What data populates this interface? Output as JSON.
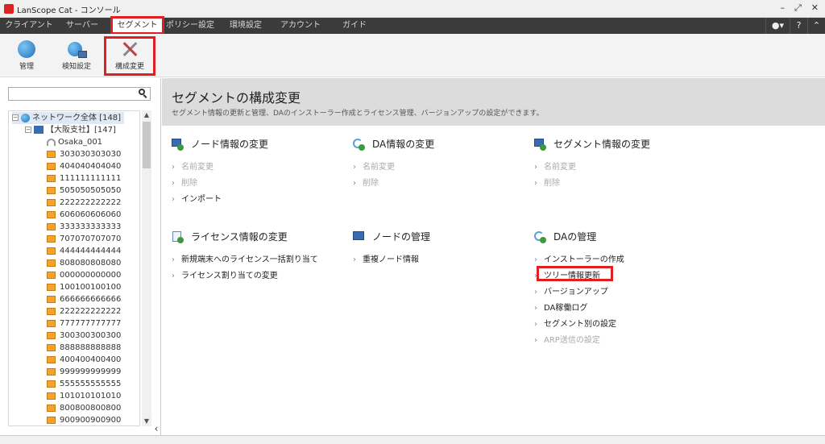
{
  "window": {
    "title": "LanScope Cat - コンソール",
    "controls": [
      "–",
      "⤢",
      "✕"
    ]
  },
  "menubar": {
    "tabs": [
      {
        "label": "クライアント",
        "active": false
      },
      {
        "label": "サーバー",
        "active": false
      },
      {
        "label": "セグメント",
        "active": true
      },
      {
        "label": "ポリシー設定",
        "active": false
      },
      {
        "label": "環境設定",
        "active": false
      },
      {
        "label": "アカウント",
        "active": false
      },
      {
        "label": "ガイド",
        "active": false
      }
    ],
    "right": {
      "user": "▾",
      "help": "?",
      "collapse": "⌃"
    }
  },
  "toolbar": {
    "items": [
      {
        "label": "管理",
        "icon": "globe-icon"
      },
      {
        "label": "検知設定",
        "icon": "network-globe-icon"
      },
      {
        "label": "構成変更",
        "icon": "tools-icon"
      }
    ]
  },
  "tree": {
    "root": {
      "label": "ネットワーク全体 [148]"
    },
    "branch": {
      "label": "【大阪支社】[147]"
    },
    "site": {
      "label": "Osaka_001"
    },
    "clients": [
      "303030303030",
      "404040404040",
      "111111111111",
      "505050505050",
      "222222222222",
      "606060606060",
      "333333333333",
      "707070707070",
      "444444444444",
      "808080808080",
      "000000000000",
      "100100100100",
      "666666666666",
      "222222222222",
      "777777777777",
      "300300300300",
      "888888888888",
      "400400400400",
      "999999999999",
      "555555555555",
      "101010101010",
      "800800800800",
      "900900900900"
    ]
  },
  "main": {
    "title": "セグメントの構成変更",
    "subtitle": "セグメント情報の更新と管理、DAのインストーラー作成とライセンス管理、バージョンアップの設定ができます。",
    "sections": [
      {
        "title": "ノード情報の変更",
        "links": [
          {
            "label": "名前変更",
            "enabled": false
          },
          {
            "label": "削除",
            "enabled": false
          },
          {
            "label": "インポート",
            "enabled": true
          }
        ]
      },
      {
        "title": "DA情報の変更",
        "links": [
          {
            "label": "名前変更",
            "enabled": false
          },
          {
            "label": "削除",
            "enabled": false
          }
        ]
      },
      {
        "title": "セグメント情報の変更",
        "links": [
          {
            "label": "名前変更",
            "enabled": false
          },
          {
            "label": "削除",
            "enabled": false
          }
        ]
      },
      {
        "title": "ライセンス情報の変更",
        "links": [
          {
            "label": "新規端末へのライセンス一括割り当て",
            "enabled": true
          },
          {
            "label": "ライセンス割り当ての変更",
            "enabled": true
          }
        ]
      },
      {
        "title": "ノードの管理",
        "links": [
          {
            "label": "重複ノード情報",
            "enabled": true
          }
        ]
      },
      {
        "title": "DAの管理",
        "links": [
          {
            "label": "インストーラーの作成",
            "enabled": true
          },
          {
            "label": "ツリー情報更新",
            "enabled": true
          },
          {
            "label": "バージョンアップ",
            "enabled": true
          },
          {
            "label": "DA稼働ログ",
            "enabled": true
          },
          {
            "label": "セグメント別の設定",
            "enabled": true
          },
          {
            "label": "ARP送信の設定",
            "enabled": false
          }
        ]
      }
    ]
  }
}
